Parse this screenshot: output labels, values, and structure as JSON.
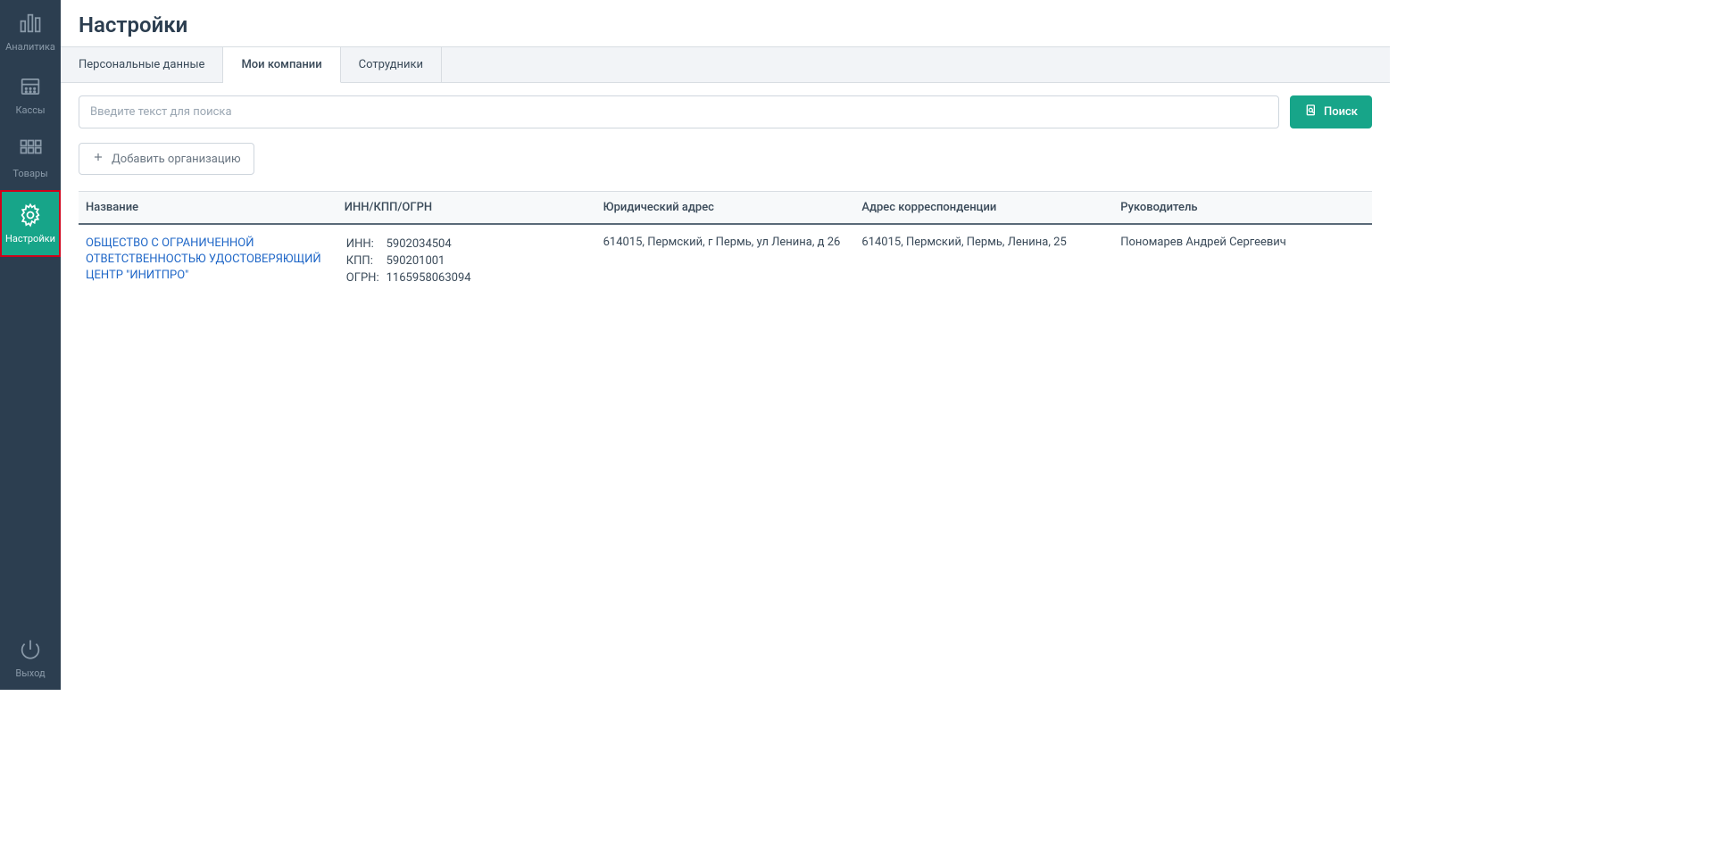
{
  "sidebar": {
    "items": [
      {
        "label": "Аналитика",
        "icon": "analytics"
      },
      {
        "label": "Кассы",
        "icon": "register"
      },
      {
        "label": "Товары",
        "icon": "apps"
      },
      {
        "label": "Настройки",
        "icon": "gear",
        "active": true
      }
    ],
    "exit_label": "Выход"
  },
  "page_title": "Настройки",
  "tabs": [
    {
      "label": "Персональные данные"
    },
    {
      "label": "Мои компании",
      "active": true
    },
    {
      "label": "Сотрудники"
    }
  ],
  "search": {
    "placeholder": "Введите текст для поиска",
    "button_label": "Поиск"
  },
  "add_button_label": "Добавить организацию",
  "table": {
    "headers": [
      "Название",
      "ИНН/КПП/ОГРН",
      "Юридический адрес",
      "Адрес корреспонденции",
      "Руководитель"
    ],
    "rows": [
      {
        "name": "ОБЩЕСТВО С ОГРАНИЧЕННОЙ ОТВЕТСТВЕННОСТЬЮ УДОСТОВЕРЯЮЩИЙ ЦЕНТР \"ИНИТПРО\"",
        "inn_label": "ИНН:",
        "inn": "5902034504",
        "kpp_label": "КПП:",
        "kpp": "590201001",
        "ogrn_label": "ОГРН:",
        "ogrn": "1165958063094",
        "legal_address": "614015, Пермский, г Пермь, ул Ленина, д 26",
        "mail_address": "614015, Пермский, Пермь, Ленина, 25",
        "director": "Пономарев Андрей Сергеевич"
      }
    ]
  }
}
